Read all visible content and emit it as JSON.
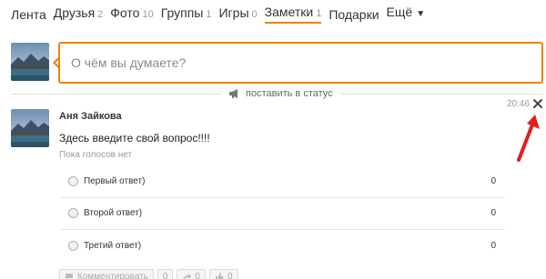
{
  "nav": {
    "items": [
      {
        "label": "Лента",
        "count": ""
      },
      {
        "label": "Друзья",
        "count": "2"
      },
      {
        "label": "Фото",
        "count": "10"
      },
      {
        "label": "Группы",
        "count": "1"
      },
      {
        "label": "Игры",
        "count": "0"
      },
      {
        "label": "Заметки",
        "count": "1",
        "active": true
      },
      {
        "label": "Подарки",
        "count": ""
      },
      {
        "label": "Ещё",
        "count": "",
        "caret": "▼"
      }
    ]
  },
  "composer": {
    "placeholder": "О чём вы думаете?"
  },
  "status_link": {
    "label": "поставить в статус",
    "icon": "megaphone-icon"
  },
  "post": {
    "author": "Аня Зайкова",
    "time": "20:46",
    "question": "Здесь введите свой вопрос!!!!",
    "votes_status": "Пока голосов нет",
    "options": [
      {
        "label": "Первый ответ)",
        "count": "0"
      },
      {
        "label": "Второй ответ)",
        "count": "0"
      },
      {
        "label": "Третий ответ)",
        "count": "0"
      }
    ]
  },
  "actions": {
    "comment": "Комментировать",
    "share_count": "0",
    "like_count": "0"
  },
  "colors": {
    "accent": "#ee8208",
    "annotation": "#e02020"
  }
}
